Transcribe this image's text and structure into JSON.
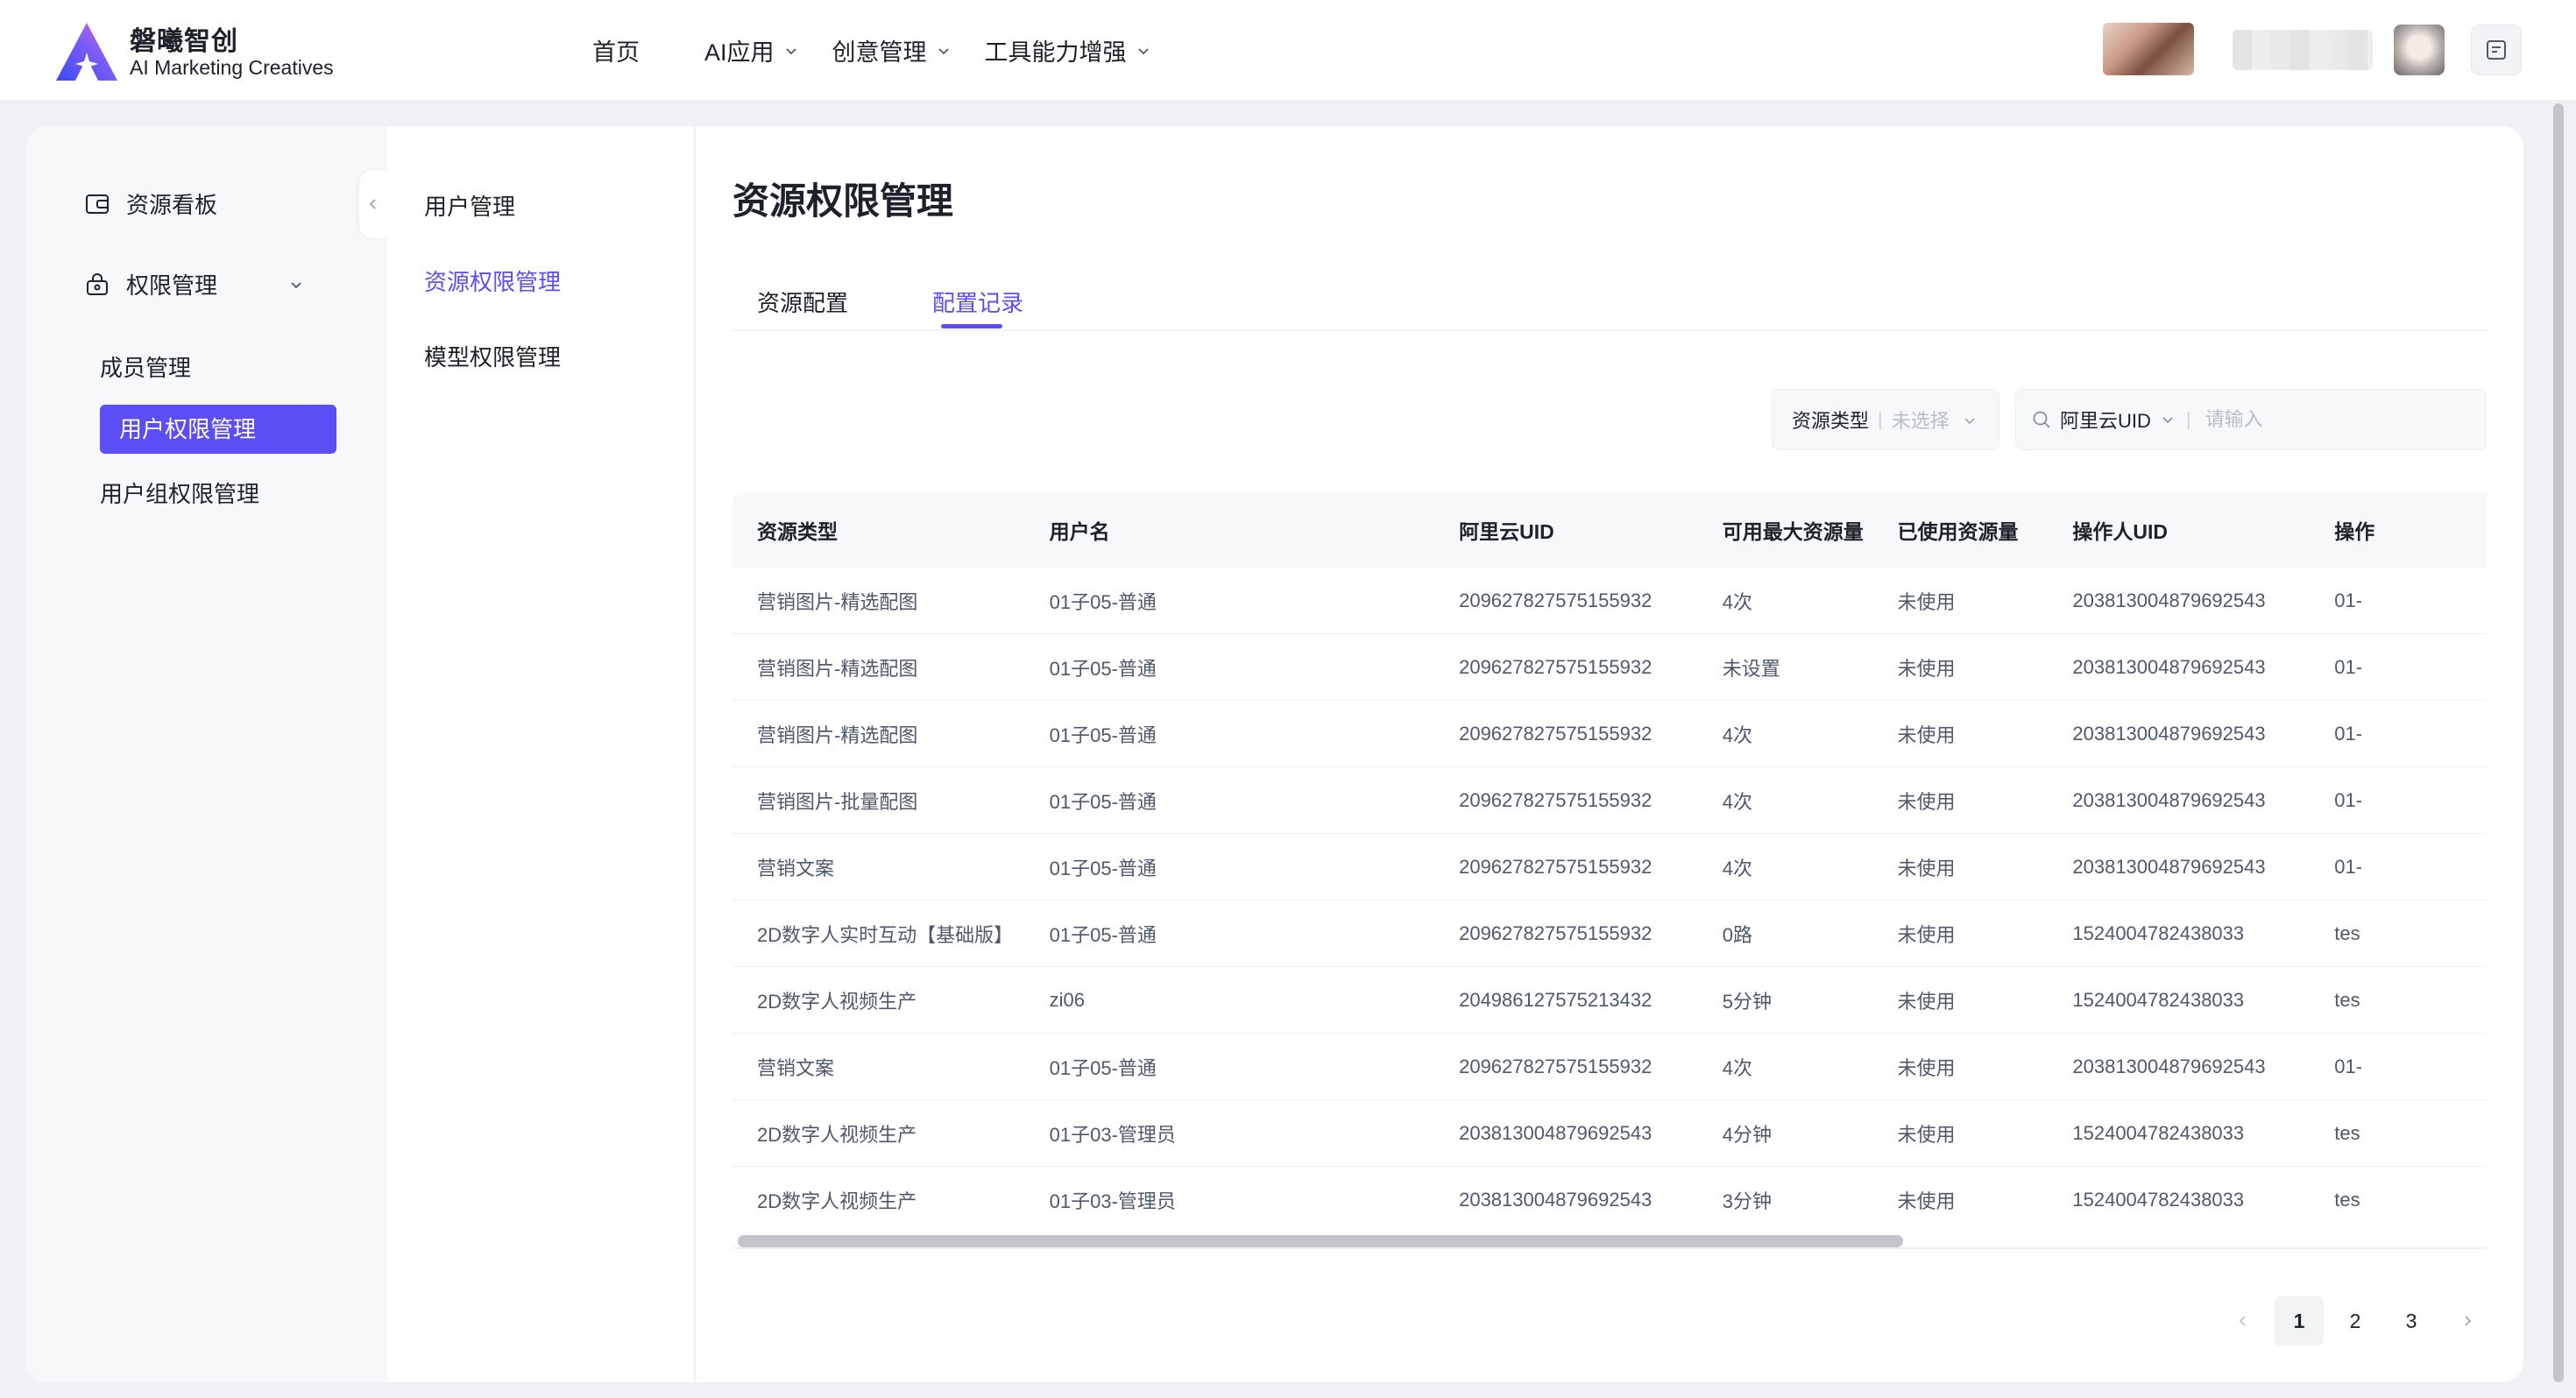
{
  "brand": {
    "name": "磐曦智创",
    "subtitle": "AI Marketing Creatives"
  },
  "topnav": [
    {
      "label": "首页",
      "dropdown": false
    },
    {
      "label": "AI应用",
      "dropdown": true
    },
    {
      "label": "创意管理",
      "dropdown": true
    },
    {
      "label": "工具能力增强",
      "dropdown": true
    }
  ],
  "sidebar": {
    "dashboard": "资源看板",
    "permission": "权限管理",
    "members": "成员管理",
    "user_permission": "用户权限管理",
    "group_permission": "用户组权限管理"
  },
  "subnav": {
    "user_mgmt": "用户管理",
    "resource_perm": "资源权限管理",
    "model_perm": "模型权限管理"
  },
  "page": {
    "title": "资源权限管理",
    "tabs": [
      "资源配置",
      "配置记录"
    ],
    "active_tab": "配置记录"
  },
  "filters": {
    "type_label": "资源类型",
    "type_placeholder": "未选择",
    "search_field": "阿里云UID",
    "search_placeholder": "请输入"
  },
  "table": {
    "columns": [
      "资源类型",
      "用户名",
      "阿里云UID",
      "可用最大资源量",
      "已使用资源量",
      "操作人UID",
      "操作"
    ],
    "rows": [
      [
        "营销图片-精选配图",
        "01子05-普通",
        "209627827575155932",
        "4次",
        "未使用",
        "203813004879692543",
        "01-"
      ],
      [
        "营销图片-精选配图",
        "01子05-普通",
        "209627827575155932",
        "未设置",
        "未使用",
        "203813004879692543",
        "01-"
      ],
      [
        "营销图片-精选配图",
        "01子05-普通",
        "209627827575155932",
        "4次",
        "未使用",
        "203813004879692543",
        "01-"
      ],
      [
        "营销图片-批量配图",
        "01子05-普通",
        "209627827575155932",
        "4次",
        "未使用",
        "203813004879692543",
        "01-"
      ],
      [
        "营销文案",
        "01子05-普通",
        "209627827575155932",
        "4次",
        "未使用",
        "203813004879692543",
        "01-"
      ],
      [
        "2D数字人实时互动【基础版】",
        "01子05-普通",
        "209627827575155932",
        "0路",
        "未使用",
        "1524004782438033",
        "tes"
      ],
      [
        "2D数字人视频生产",
        "zi06",
        "204986127575213432",
        "5分钟",
        "未使用",
        "1524004782438033",
        "tes"
      ],
      [
        "营销文案",
        "01子05-普通",
        "209627827575155932",
        "4次",
        "未使用",
        "203813004879692543",
        "01-"
      ],
      [
        "2D数字人视频生产",
        "01子03-管理员",
        "203813004879692543",
        "4分钟",
        "未使用",
        "1524004782438033",
        "tes"
      ],
      [
        "2D数字人视频生产",
        "01子03-管理员",
        "203813004879692543",
        "3分钟",
        "未使用",
        "1524004782438033",
        "tes"
      ]
    ]
  },
  "pagination": {
    "pages": [
      "1",
      "2",
      "3"
    ],
    "current": "1"
  },
  "colors": {
    "accent": "#5b4ef5",
    "page_bg": "#f0f1f5",
    "sidebar_bg": "#f7f8fa"
  }
}
